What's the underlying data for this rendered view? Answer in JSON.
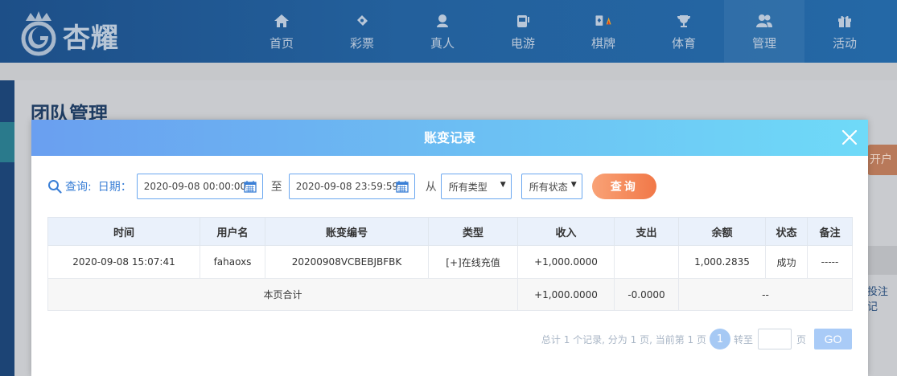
{
  "brand": {
    "logo_text": "杏耀"
  },
  "nav": {
    "items": [
      {
        "label": "首页",
        "icon": "home-icon"
      },
      {
        "label": "彩票",
        "icon": "lottery-icon"
      },
      {
        "label": "真人",
        "icon": "live-dealer-icon"
      },
      {
        "label": "电游",
        "icon": "slot-machine-icon"
      },
      {
        "label": "棋牌",
        "icon": "cards-icon"
      },
      {
        "label": "体育",
        "icon": "trophy-icon"
      },
      {
        "label": "管理",
        "icon": "users-icon"
      },
      {
        "label": "活动",
        "icon": "gift-icon"
      }
    ]
  },
  "page": {
    "title": "团队管理",
    "side_button_partial": "开户",
    "side_link_partial": "投注记"
  },
  "modal": {
    "title": "账变记录",
    "filter": {
      "query_label": "查询:",
      "date_label": "日期：",
      "date_from": "2020-09-08 00:00:00",
      "to_label": "至",
      "date_to": "2020-09-08 23:59:59",
      "from_label": "从",
      "type_select": "所有类型",
      "status_select": "所有状态",
      "query_button": "查询"
    },
    "table": {
      "headers": [
        "时间",
        "用户名",
        "账变编号",
        "类型",
        "收入",
        "支出",
        "余额",
        "状态",
        "备注"
      ],
      "rows": [
        {
          "time": "2020-09-08 15:07:41",
          "username": "fahaoxs",
          "txn_id": "20200908VCBEBJBFBK",
          "type": "[+]在线充值",
          "income": "+1,000.0000",
          "expense": "",
          "balance": "1,000.2835",
          "status": "成功",
          "remark": "-----"
        }
      ],
      "total": {
        "label": "本页合计",
        "income": "+1,000.0000",
        "expense": "-0.0000",
        "balance": "--"
      }
    },
    "pager": {
      "summary": "总计 1 个记录, 分为 1 页, 当前第 1 页",
      "current_page": "1",
      "goto_label": "转至",
      "page_unit": "页",
      "go_button": "GO"
    }
  },
  "colors": {
    "accent_blue": "#3a7fd6",
    "income_green": "#3f9c35",
    "query_orange": "#f17848"
  }
}
